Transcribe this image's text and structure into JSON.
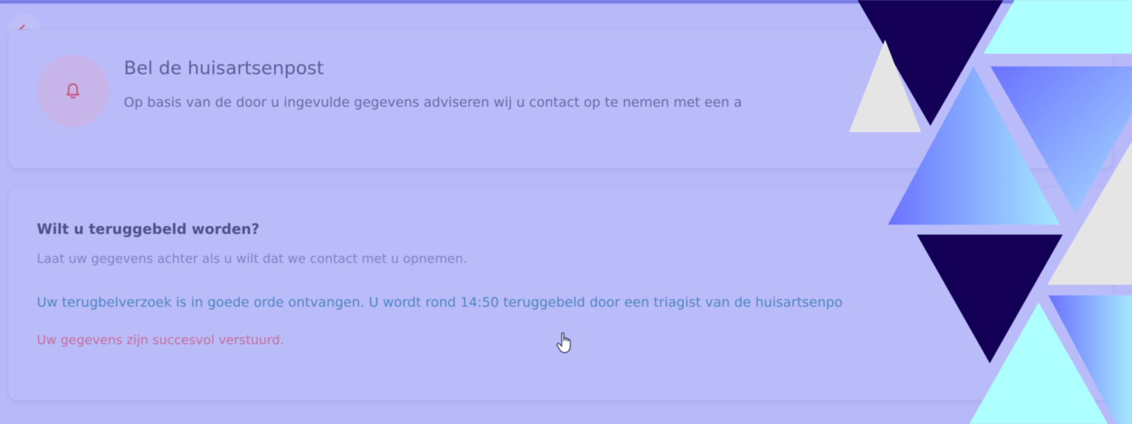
{
  "colors": {
    "background": "#b8b9f8",
    "accent_bar": "#7a7ce8",
    "alert_red": "#c45a7a",
    "confirm_blue": "#4e86c0",
    "success_pink": "#c46f9a",
    "navy": "#130056",
    "cyan": "#aeffff",
    "light_gray": "#e5e5e5",
    "blue_gradient_start": "#6a72ff",
    "blue_gradient_end": "#a6d8ff"
  },
  "icons": {
    "back": "arrow-left-icon",
    "alert": "bell-icon",
    "cursor": "hand-pointer-icon"
  },
  "alert_card": {
    "title": "Bel de huisartsenpost",
    "text": "Op basis van de door u ingevulde gegevens adviseren wij u contact op te nemen met een a"
  },
  "callback_card": {
    "title": "Wilt u teruggebeld worden?",
    "subtitle": "Laat uw gegevens achter als u wilt dat we contact met u opnemen.",
    "confirmation": "Uw terugbelverzoek is in goede orde ontvangen. U wordt rond 14:50 teruggebeld door een triagist van de huisartsenpo",
    "success": "Uw gegevens zijn succesvol verstuurd."
  }
}
